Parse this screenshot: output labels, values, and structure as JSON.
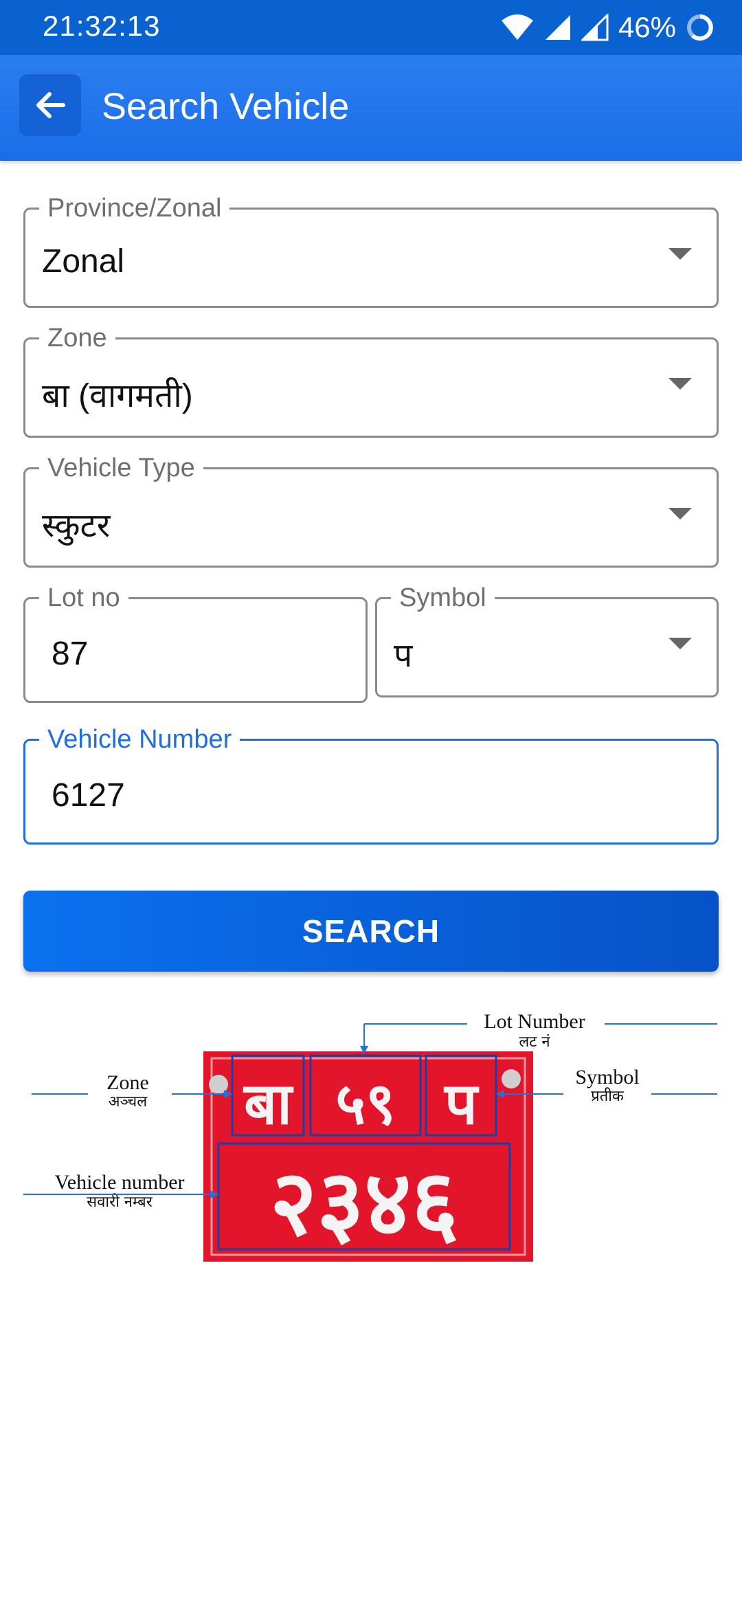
{
  "status_bar": {
    "time": "21:32:13",
    "battery": "46%"
  },
  "app_bar": {
    "title": "Search Vehicle",
    "back_icon": "arrow-left-icon"
  },
  "form": {
    "province": {
      "label": "Province/Zonal",
      "value": "Zonal"
    },
    "zone": {
      "label": "Zone",
      "value": "बा  (वागमती)"
    },
    "vehicle_type": {
      "label": "Vehicle Type",
      "value": "स्कुटर"
    },
    "lot_no": {
      "label": "Lot no",
      "value": "87"
    },
    "symbol": {
      "label": "Symbol",
      "value": "प"
    },
    "vehicle_number": {
      "label": "Vehicle Number",
      "value": "6127"
    }
  },
  "search_button": {
    "label": "SEARCH"
  },
  "diagram": {
    "plate_row1": [
      "बा",
      "५९",
      "प"
    ],
    "plate_row2": "२३४६",
    "labels": {
      "lot_en": "Lot Number",
      "lot_np": "लट नं",
      "zone_en": "Zone",
      "zone_np": "अञ्चल",
      "symbol_en": "Symbol",
      "symbol_np": "प्रतीक",
      "vehicle_en": "Vehicle number",
      "vehicle_np": "सवारी नम्बर"
    },
    "colors": {
      "plate": "#e3152a",
      "box": "#1d3fa8",
      "line": "#2a6fd6"
    }
  }
}
